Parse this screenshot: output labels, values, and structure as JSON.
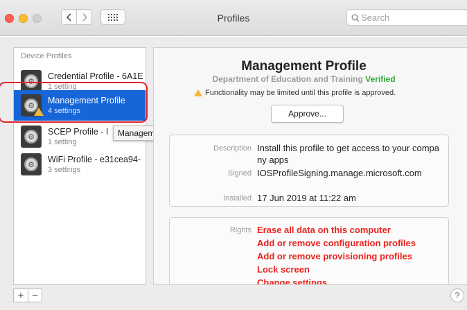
{
  "window": {
    "title": "Profiles"
  },
  "search": {
    "placeholder": "Search"
  },
  "sidebar": {
    "header": "Device Profiles",
    "items": [
      {
        "name": "Credential Profile - 6A1E",
        "sub": "1 setting",
        "selected": false
      },
      {
        "name": "Management Profile",
        "sub": "4 settings",
        "selected": true
      },
      {
        "name": "SCEP Profile - I",
        "sub": "1 setting",
        "selected": false
      },
      {
        "name": "WiFi Profile - e31cea94-",
        "sub": "3 settings",
        "selected": false
      }
    ],
    "tooltip": "Management Profile"
  },
  "detail": {
    "title": "Management Profile",
    "org": "Department of Education and Training",
    "verified": "Verified",
    "warning": "Functionality may be limited until this profile is approved.",
    "approve_label": "Approve...",
    "description_label": "Description",
    "description": "Install this profile to get access to your company apps",
    "signed_label": "Signed",
    "signed": "IOSProfileSigning.manage.microsoft.com",
    "installed_label": "Installed",
    "installed": "17 Jun 2019 at 11:22 am",
    "rights_label": "Rights",
    "rights": [
      "Erase all data on this computer",
      "Add or remove configuration profiles",
      "Add or remove provisioning profiles",
      "Lock screen",
      "Change settings"
    ]
  },
  "controls": {
    "plus": "+",
    "minus": "−",
    "help": "?"
  },
  "colors": {
    "selection": "#1765d8",
    "verified": "#2fa93b",
    "rights": "#e8231f",
    "ring": "#e0222a",
    "warning": "#f2b634"
  }
}
